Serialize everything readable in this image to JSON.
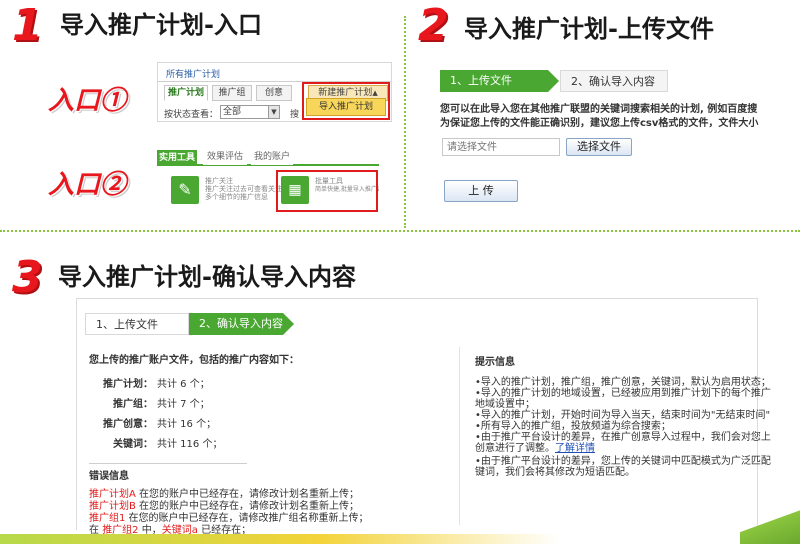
{
  "step1": {
    "number": "1",
    "title": "导入推广计划-入口",
    "entry1_label": "入口①",
    "entry2_label": "入口②",
    "shot1": {
      "header": "所有推广计划",
      "tabs": [
        "推广计划",
        "推广组",
        "创意",
        "关键词"
      ],
      "new_plan_button": "新建推广计划",
      "new_plan_arrow": "▲",
      "import_item": "导入推广计划",
      "filter_label": "按状态查看：",
      "filter_value": "全部",
      "filter_suffix": "搜"
    },
    "shot2": {
      "tabs": [
        "实用工具",
        "效果评估",
        "我的账户"
      ],
      "tool1_title": "推广关注",
      "tool1_desc1": "推广关注过去可查看关注",
      "tool1_desc2": "多个细节的推广信息",
      "tool2_title": "批量工具",
      "tool2_desc": "简单快捷,批量导入推广计划"
    }
  },
  "step2": {
    "number": "2",
    "title": "导入推广计划-上传文件",
    "wizard": [
      "1、上传文件",
      "2、确认导入内容"
    ],
    "desc1": "您可以在此导入您在其他推广联盟的关键词搜索相关的计划, 例如百度搜",
    "desc2": "为保证您上传的文件能正确识别，建议您上传csv格式的文件，文件大小",
    "file_placeholder": "请选择文件",
    "choose_button": "选择文件",
    "upload_button": "上 传"
  },
  "step3": {
    "number": "3",
    "title": "导入推广计划-确认导入内容",
    "wizard": [
      "1、上传文件",
      "2、确认导入内容"
    ],
    "summary_title": "您上传的推广账户文件，包括的推广内容如下：",
    "summary": [
      {
        "label": "推广计划：",
        "value": "共计 6 个；"
      },
      {
        "label": "推广组：",
        "value": "共计 7 个；"
      },
      {
        "label": "推广创意：",
        "value": "共计 16 个；"
      },
      {
        "label": "关键词：",
        "value": "共计 116 个；"
      }
    ],
    "error_title": "错误信息",
    "errors": [
      {
        "red": "推广计划A",
        "rest": " 在您的账户中已经存在，请修改计划名重新上传；"
      },
      {
        "red": "推广计划B",
        "rest": " 在您的账户中已经存在，请修改计划名重新上传；"
      },
      {
        "red": "推广组1",
        "rest": " 在您的账户中已经存在，请修改推广组名称重新上传；"
      }
    ],
    "error4_a": "在 ",
    "error4_b": "推广组2",
    "error4_c": " 中，",
    "error4_d": "关键词a",
    "error4_e": " 已经存在；",
    "tips_title": "提示信息",
    "tips": [
      "•导入的推广计划，推广组，推广创意，关键词，默认为启用状态；",
      "•导入的推广计划的地域设置，已经被应用到推广计划下的每个推广",
      "  地域设置中；",
      "•导入的推广计划，开始时间为导入当天，结束时间为\"无结束时间\"",
      "•所有导入的推广组，投放频道为综合搜索；",
      "•由于推广平台设计的差异，在推广创意导入过程中，我们会对您上",
      "  创意进行了调整。"
    ],
    "tips_link": "了解详情",
    "tips_tail": [
      "•由于推广平台设计的差异，您上传的关键词中匹配模式为广泛匹配",
      "  键词，我们会将其修改为短语匹配。"
    ]
  },
  "colors": {
    "accent_red": "#e8171e",
    "accent_green": "#4aa832",
    "divider_green": "#8bc53f"
  }
}
